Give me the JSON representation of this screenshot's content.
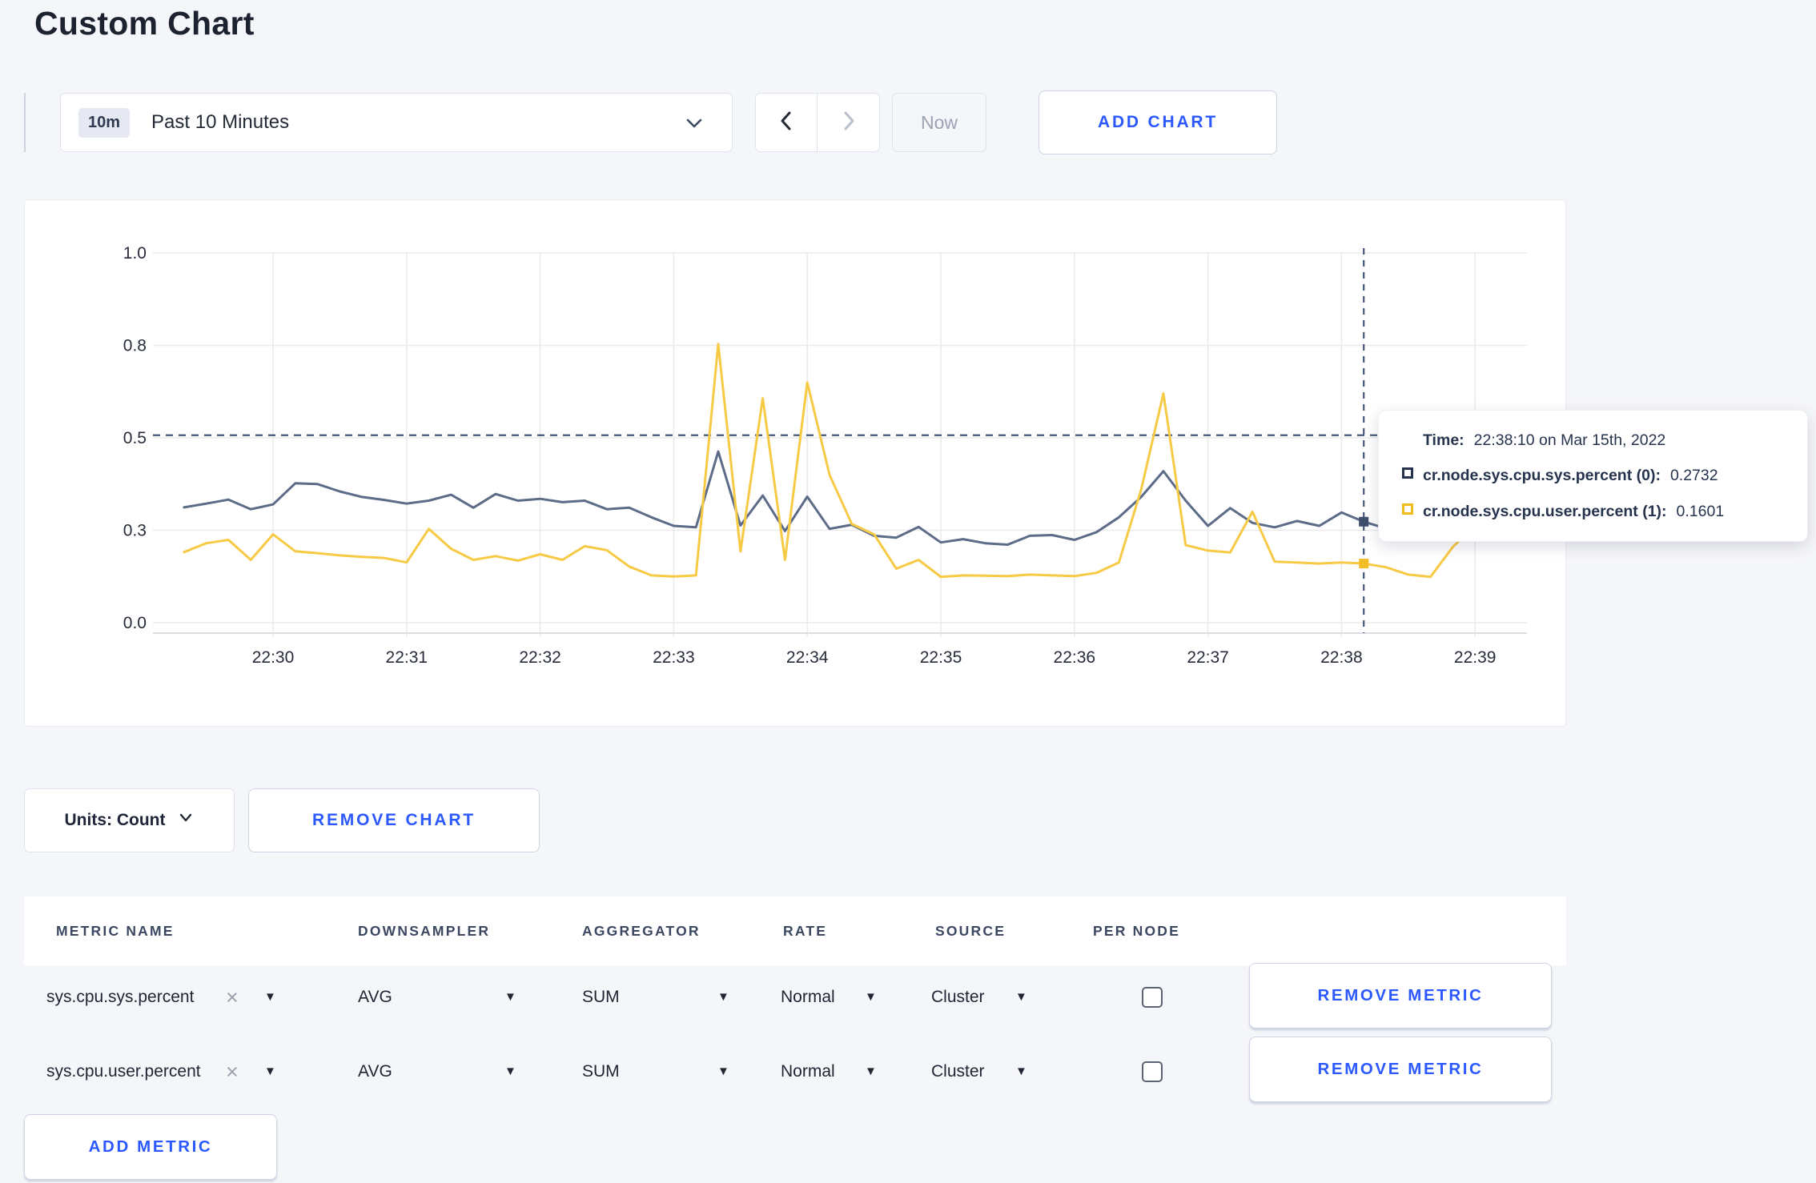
{
  "page": {
    "title": "Custom Chart"
  },
  "colors": {
    "accent_blue": "#2b59ff",
    "series_sys": "#5c6b87",
    "series_user": "#f7ca45",
    "tooltip_sys_square": "#26334d",
    "tooltip_user_square": "#f0bc1d",
    "crosshair": "#45577c",
    "gridline": "#ebebeb",
    "page_background": "#f5f6f9"
  },
  "icons": {
    "caret_down": "▼",
    "close": "×"
  },
  "toolbar": {
    "time_range": {
      "badge": "10m",
      "label": "Past 10 Minutes"
    },
    "now_label": "Now",
    "add_chart_label": "ADD CHART"
  },
  "chart_data": {
    "type": "line",
    "title": "",
    "xlabel": "",
    "ylabel": "",
    "ylim": [
      0,
      1
    ],
    "grid": true,
    "legend_position": "tooltip",
    "y_tick_labels": [
      "0.0",
      "0.3",
      "0.5",
      "0.8",
      "1.0"
    ],
    "y_tick_values": [
      0,
      0.25,
      0.5,
      0.75,
      1.0
    ],
    "x_ticks": [
      "22:30",
      "22:31",
      "22:32",
      "22:33",
      "22:34",
      "22:35",
      "22:36",
      "22:37",
      "22:38",
      "22:39"
    ],
    "x_start_label": "22:29:20",
    "interval_seconds": 10,
    "series": [
      {
        "name": "cr.node.sys.cpu.sys.percent",
        "color": "#5c6b87",
        "values": [
          0.312,
          0.322,
          0.333,
          0.307,
          0.32,
          0.377,
          0.375,
          0.355,
          0.34,
          0.332,
          0.322,
          0.33,
          0.346,
          0.311,
          0.348,
          0.33,
          0.335,
          0.326,
          0.33,
          0.307,
          0.311,
          0.285,
          0.262,
          0.258,
          0.463,
          0.263,
          0.344,
          0.248,
          0.341,
          0.254,
          0.265,
          0.235,
          0.23,
          0.259,
          0.217,
          0.226,
          0.215,
          0.211,
          0.235,
          0.237,
          0.224,
          0.245,
          0.285,
          0.34,
          0.41,
          0.33,
          0.262,
          0.31,
          0.27,
          0.258,
          0.275,
          0.262,
          0.298,
          0.2732,
          0.255,
          0.268,
          0.295,
          0.305,
          0.295,
          0.3,
          0.288
        ]
      },
      {
        "name": "cr.node.sys.cpu.user.percent",
        "color": "#f7ca45",
        "values": [
          0.191,
          0.215,
          0.224,
          0.17,
          0.239,
          0.193,
          0.188,
          0.182,
          0.178,
          0.175,
          0.163,
          0.254,
          0.2,
          0.17,
          0.18,
          0.168,
          0.185,
          0.17,
          0.207,
          0.196,
          0.152,
          0.128,
          0.125,
          0.128,
          0.754,
          0.193,
          0.607,
          0.17,
          0.65,
          0.4,
          0.267,
          0.239,
          0.146,
          0.17,
          0.124,
          0.128,
          0.127,
          0.126,
          0.13,
          0.128,
          0.126,
          0.135,
          0.163,
          0.36,
          0.62,
          0.21,
          0.195,
          0.19,
          0.3,
          0.165,
          0.163,
          0.16,
          0.163,
          0.1601,
          0.15,
          0.13,
          0.124,
          0.205,
          0.262,
          0.225,
          0.255
        ]
      }
    ],
    "crosshair": {
      "index": 53,
      "time": "22:38:10",
      "hline_value": 0.507
    }
  },
  "tooltip": {
    "time_label": "Time:",
    "time_value": "22:38:10 on Mar 15th, 2022",
    "series": [
      {
        "name": "cr.node.sys.cpu.sys.percent (0):",
        "value": "0.2732"
      },
      {
        "name": "cr.node.sys.cpu.user.percent (1):",
        "value": "0.1601"
      }
    ]
  },
  "chart_footer": {
    "units_label": "Units: Count",
    "remove_chart_label": "REMOVE CHART"
  },
  "table": {
    "columns": [
      "METRIC NAME",
      "DOWNSAMPLER",
      "AGGREGATOR",
      "RATE",
      "SOURCE",
      "PER NODE"
    ],
    "rows": [
      {
        "metric": "sys.cpu.sys.percent",
        "downsampler": "AVG",
        "aggregator": "SUM",
        "rate": "Normal",
        "source": "Cluster",
        "per_node_checked": false,
        "remove_label": "REMOVE METRIC"
      },
      {
        "metric": "sys.cpu.user.percent",
        "downsampler": "AVG",
        "aggregator": "SUM",
        "rate": "Normal",
        "source": "Cluster",
        "per_node_checked": false,
        "remove_label": "REMOVE METRIC"
      }
    ],
    "add_metric_label": "ADD METRIC"
  }
}
